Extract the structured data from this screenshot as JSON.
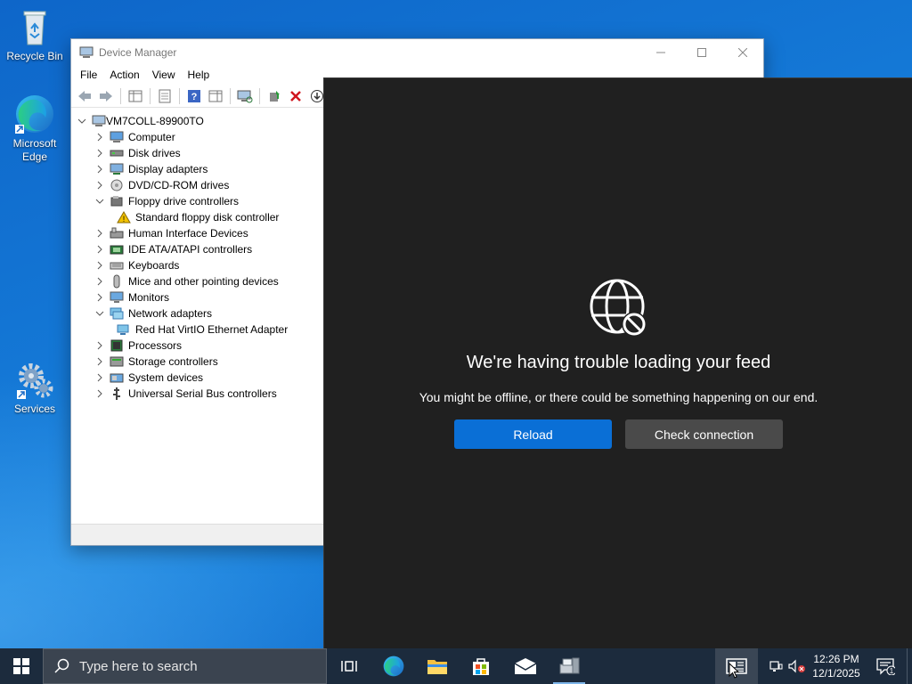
{
  "desktop": {
    "icons": [
      {
        "label": "Recycle Bin"
      },
      {
        "label": "Microsoft Edge"
      },
      {
        "label": "Services"
      }
    ]
  },
  "device_manager": {
    "title": "Device Manager",
    "menu": [
      "File",
      "Action",
      "View",
      "Help"
    ],
    "root": "VM7COLL-89900TO",
    "tree": [
      {
        "label": "Computer",
        "expanded": false
      },
      {
        "label": "Disk drives",
        "expanded": false
      },
      {
        "label": "Display adapters",
        "expanded": false
      },
      {
        "label": "DVD/CD-ROM drives",
        "expanded": false
      },
      {
        "label": "Floppy drive controllers",
        "expanded": true
      },
      {
        "label": "Standard floppy disk controller",
        "child": true,
        "warning": true
      },
      {
        "label": "Human Interface Devices",
        "expanded": false
      },
      {
        "label": "IDE ATA/ATAPI controllers",
        "expanded": false
      },
      {
        "label": "Keyboards",
        "expanded": false
      },
      {
        "label": "Mice and other pointing devices",
        "expanded": false
      },
      {
        "label": "Monitors",
        "expanded": false
      },
      {
        "label": "Network adapters",
        "expanded": true
      },
      {
        "label": "Red Hat VirtIO Ethernet Adapter",
        "child": true
      },
      {
        "label": "Processors",
        "expanded": false
      },
      {
        "label": "Storage controllers",
        "expanded": false
      },
      {
        "label": "System devices",
        "expanded": false
      },
      {
        "label": "Universal Serial Bus controllers",
        "expanded": false
      }
    ]
  },
  "feed": {
    "title": "We're having trouble loading your feed",
    "message": "You might be offline, or there could be something happening on our end.",
    "reload_label": "Reload",
    "check_label": "Check connection"
  },
  "taskbar": {
    "search_placeholder": "Type here to search",
    "time": "12:26 PM",
    "date": "12/1/2025",
    "notification_count": "1"
  },
  "colors": {
    "accent": "#0a6fd6",
    "feed_bg": "#202020",
    "taskbar_bg": "#1c2b3d"
  }
}
